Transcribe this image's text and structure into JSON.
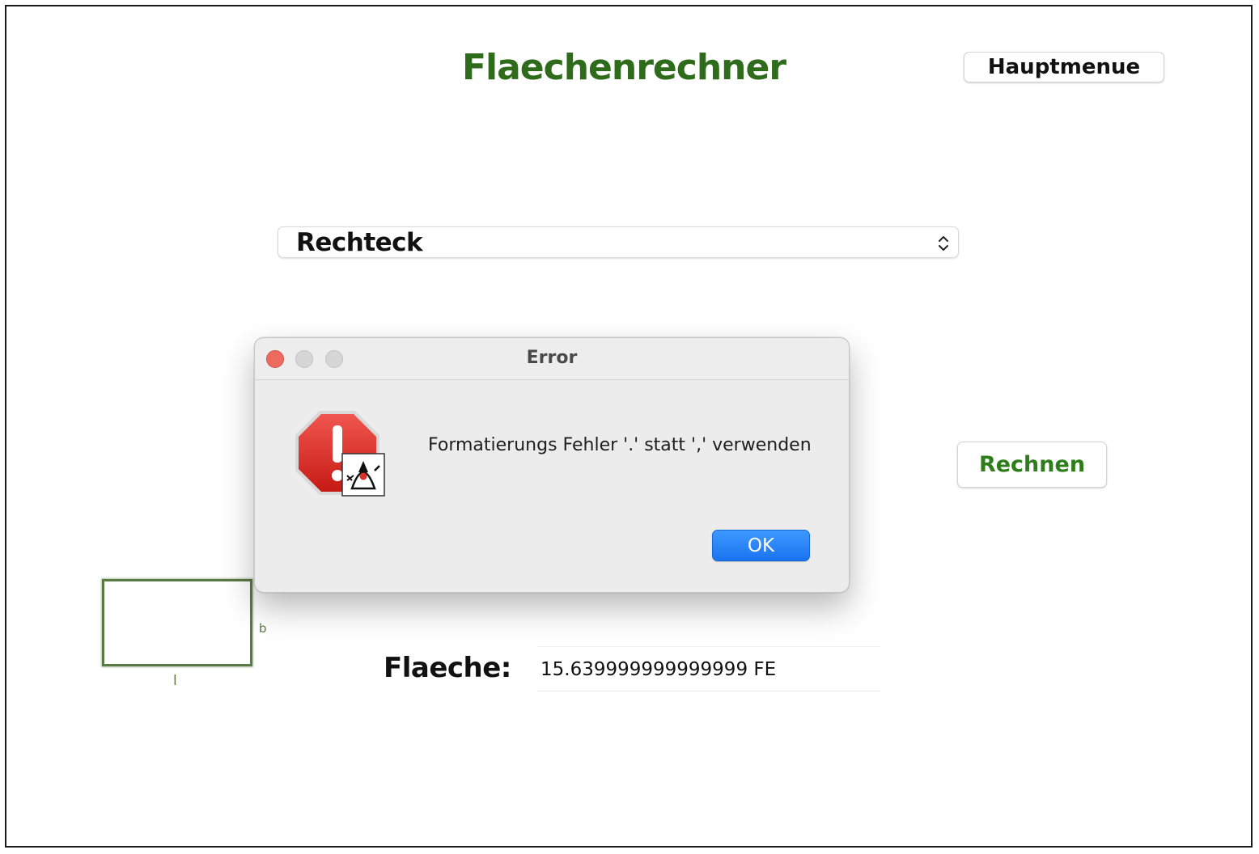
{
  "app": {
    "title": "Flaechenrechner",
    "menu_button_label": "Hauptmenue",
    "compute_button_label": "Rechnen"
  },
  "shape_select": {
    "selected": "Rechteck",
    "icon": "up-down-chevron-icon"
  },
  "shape_preview": {
    "label_b": "b",
    "label_l": "l"
  },
  "result": {
    "label": "Flaeche:",
    "value": "15.639999999999999 FE"
  },
  "dialog": {
    "title": "Error",
    "message": "Formatierungs Fehler '.' statt ',' verwenden",
    "ok_label": "OK",
    "icon": "java-stop-error-icon"
  },
  "colors": {
    "title_green": "#2e6b1b",
    "button_green": "#2e7d1b",
    "ok_blue": "#1a74f0",
    "close_red": "#ed6a5e"
  }
}
